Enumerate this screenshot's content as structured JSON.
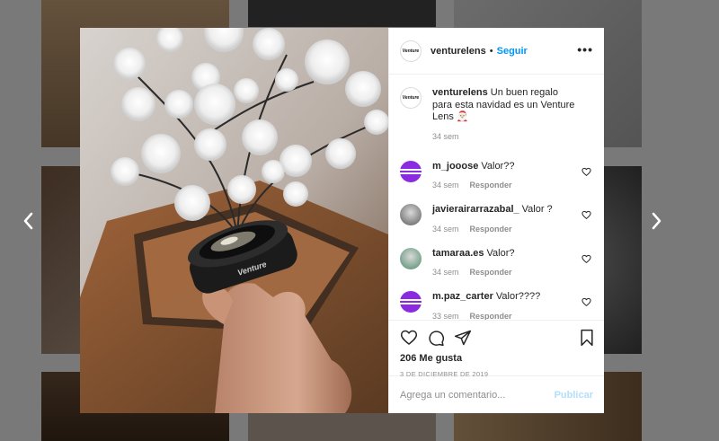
{
  "post": {
    "username": "venturelens",
    "follow_label": "Seguir",
    "dot": "•",
    "more_label": "•••",
    "avatar_logo_text": "Venture",
    "lens_brand": "Venture"
  },
  "caption": {
    "username": "venturelens",
    "text": "Un buen regalo para esta navidad es un Venture Lens 🎅🏻",
    "time": "34 sem"
  },
  "comments": [
    {
      "username": "m_jooose",
      "text": "Valor??",
      "time": "34 sem",
      "reply": "Responder",
      "avatar_color": "#8a2be2"
    },
    {
      "username": "javierairarrazabal_",
      "text": "Valor ?",
      "time": "34 sem",
      "reply": "Responder",
      "avatar_color": "#5a5a5a"
    },
    {
      "username": "tamaraa.es",
      "text": "Valor?",
      "time": "34 sem",
      "reply": "Responder",
      "avatar_color": "#4d8b6b"
    },
    {
      "username": "m.paz_carter",
      "text": "Valor????",
      "time": "33 sem",
      "reply": "Responder",
      "avatar_color": "#8a2be2"
    }
  ],
  "footer": {
    "likes": "206 Me gusta",
    "date": "3 DE DICIEMBRE DE 2019",
    "comment_placeholder": "Agrega un comentario...",
    "publish_label": "Publicar"
  },
  "colors": {
    "accent": "#0095f6",
    "publish_disabled": "#b2dffc",
    "muted": "#8e8e8e",
    "text": "#262626"
  },
  "icons": {
    "nav_prev": "chevron-left-icon",
    "nav_next": "chevron-right-icon",
    "like": "heart-icon",
    "comment": "comment-icon",
    "share": "paper-plane-icon",
    "save": "bookmark-icon"
  }
}
